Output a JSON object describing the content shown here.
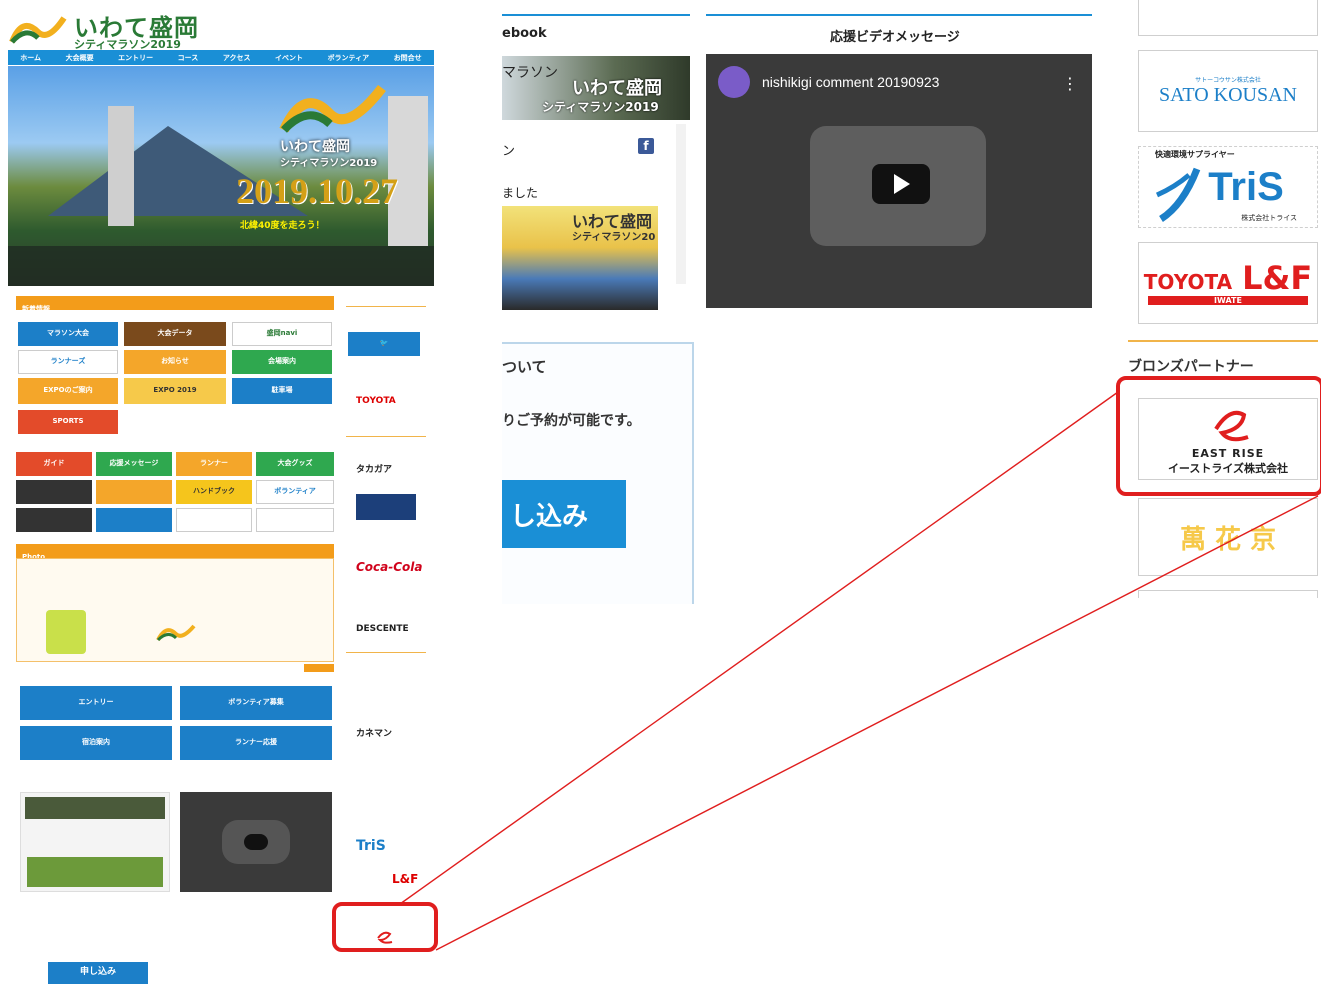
{
  "site": {
    "logo_main": "いわて盛岡",
    "logo_sub": "シティマラソン2019",
    "nav": [
      "ホーム",
      "大会概要",
      "エントリー",
      "コース",
      "アクセス",
      "イベント",
      "ボランティア",
      "お問合せ"
    ],
    "hero": {
      "title": "いわて盛岡",
      "subtitle": "シティマラソン2019",
      "date": "2019.10.27",
      "tagline": "北緯40度を走ろう！"
    },
    "section_label": "新着情報",
    "tiles_row1": [
      "マラソン大会",
      "大会データ",
      "盛岡navi"
    ],
    "tiles_row2": [
      "ランナーズ",
      "お知らせ",
      "会場案内"
    ],
    "tiles_row3": [
      "EXPOのご案内",
      "EXPO 2019",
      "駐車場"
    ],
    "tiles_row4": [
      "SPORTS"
    ],
    "tiles_mid": [
      "ガイド",
      "応援メッセージ",
      "ランナー",
      "大会グッズ",
      "ハンドブック",
      "ボランティア"
    ],
    "tiles_bottom_left": [
      "エントリー",
      "宿泊案内"
    ],
    "tiles_bottom_right": [
      "ボランティア募集",
      "ランナー応援"
    ],
    "photo_label": "Photo",
    "sidebar_sponsors": [
      "TOYOTA",
      "タカガア",
      "Coca-Cola",
      "DESCENTE",
      "カネマン",
      "TriS",
      "L&F"
    ],
    "apply": "申し込み"
  },
  "middle": {
    "facebook_heading": "ebook",
    "fb_post_line1": "マラソン",
    "fb_post_line2": "ン",
    "fb_post_line3": "ました",
    "fb_banner_title": "いわて盛岡",
    "fb_banner_sub": "シティマラソン2019",
    "fb_photo_title": "いわて盛岡",
    "fb_photo_sub": "シティマラソン20",
    "fb_icon": "f",
    "video_heading": "応援ビデオメッセージ",
    "video_title": "nishikigi comment 20190923",
    "about_heading": "ついて",
    "about_text": "りご予約が可能です。",
    "apply_button": "し込み"
  },
  "right": {
    "sponsor_sato": "SATO KOUSAN",
    "sponsor_sato_small": "サトーコウサン株式会社",
    "sponsor_tris_label": "快適環境サプライヤー",
    "sponsor_tris": "TriS",
    "sponsor_tris_company": "株式会社トライス",
    "sponsor_toyota": "TOYOTA",
    "sponsor_lf": "L&F",
    "sponsor_lf_sub": "IWATE",
    "bronze_heading": "ブロンズパートナー",
    "east_rise_en": "EAST RISE",
    "east_rise_ja": "イーストライズ株式会社",
    "next_sponsor": "萬 花 京"
  },
  "colors": {
    "highlight": "#e01e1e",
    "accent_blue": "#1a8fd6",
    "accent_orange": "#f39c1a",
    "brand_green": "#2a7a36"
  }
}
